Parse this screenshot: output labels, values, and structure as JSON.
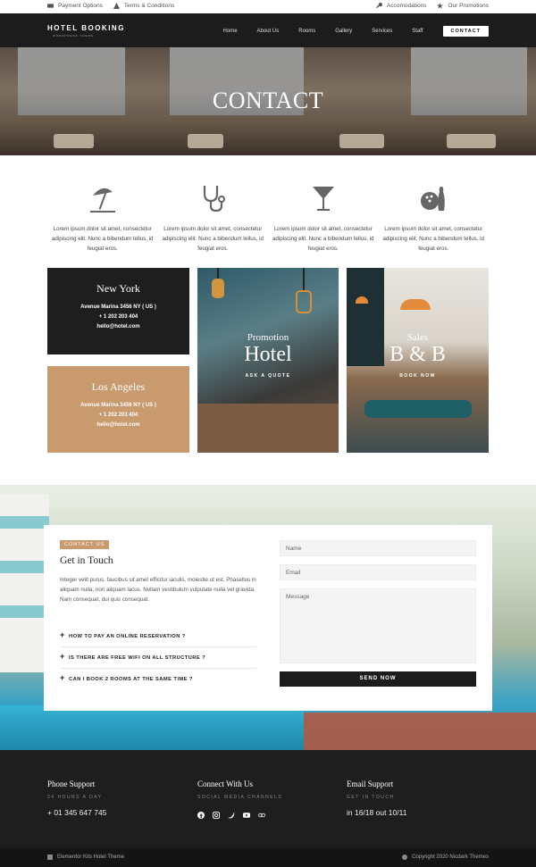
{
  "topbar": {
    "left": [
      "Payment Options",
      "Terms & Conditions"
    ],
    "right": [
      "Accomodations",
      "Our Promotions"
    ]
  },
  "nav": {
    "logo": "HOTEL BOOKING",
    "logo_sub": "WORDPRESS THEME",
    "menu": [
      "Home",
      "About Us",
      "Rooms",
      "Gallery",
      "Services",
      "Staff"
    ],
    "cta": "CONTACT"
  },
  "hero": {
    "title": "CONTACT"
  },
  "features": [
    {
      "icon": "beach-umbrella-icon",
      "text": "Lorem ipsum dolor sit amet, consectetur adipiscing elit. Nunc a bibendum tellus, id feugiat eros."
    },
    {
      "icon": "stethoscope-icon",
      "text": "Lorem ipsum dolor sit amet, consectetur adipiscing elit. Nunc a bibendum tellus, id feugiat eros."
    },
    {
      "icon": "cocktail-icon",
      "text": "Lorem ipsum dolor sit amet, consectetur adipiscing elit. Nunc a bibendum tellus, id feugiat eros."
    },
    {
      "icon": "bowling-icon",
      "text": "Lorem ipsum dolor sit amet, consectetur adipiscing elit. Nunc a bibendum tellus, id feugiat eros."
    }
  ],
  "cities": [
    {
      "name": "New York",
      "address": "Avenue Marina 3456 NY ( US )",
      "phone": "+ 1 202 203 404",
      "email": "hello@hotel.com",
      "color": "#1e1e1e"
    },
    {
      "name": "Los Angeles",
      "address": "Avenue Marina 3456 NY ( US )",
      "phone": "+ 1 202 203 404",
      "email": "hello@hotel.com",
      "color": "#c99a6e"
    }
  ],
  "promo": {
    "small": "Promotion",
    "big": "Hotel",
    "link": "ASK A QUOTE"
  },
  "sales": {
    "small": "Sales",
    "big": "B & B",
    "link": "BOOK NOW"
  },
  "contact": {
    "tag": "CONTACT US",
    "title": "Get in Touch",
    "paragraph": "Integer velit purus, faucibus sit amet efficitur iaculis, molestie ut est. Phasellus in aliquam nulla, non aliquam lacus. Nullam vestibulum vulputate nulla vel gravida. Nam consequat, dui quis consequat.",
    "faqs": [
      "HOW TO PAY AN ONLINE RESERVATION ?",
      "IS THERE ARE FREE WIFI ON ALL STRUCTURE ?",
      "CAN I BOOK 2 ROOMS AT THE SAME TIME ?"
    ],
    "placeholders": {
      "name": "Name",
      "email": "Email",
      "message": "Message"
    },
    "send": "SEND NOW"
  },
  "footer": {
    "phone": {
      "title": "Phone Support",
      "sub": "24 HOURS A DAY",
      "value": "+ 01 345 647 745"
    },
    "social": {
      "title": "Connect With Us",
      "sub": "SOCIAL MEDIA CHANNELS",
      "icons": [
        "facebook-icon",
        "instagram-icon",
        "twitter-icon",
        "youtube-icon",
        "tripadvisor-icon"
      ]
    },
    "email": {
      "title": "Email Support",
      "sub": "GET IN TOUCH",
      "value": "in 16/18 out 10/11"
    }
  },
  "bottom": {
    "left": "Elementor Kits Hotel Theme",
    "right": "Copyright 2020 Nicdark Themes"
  }
}
